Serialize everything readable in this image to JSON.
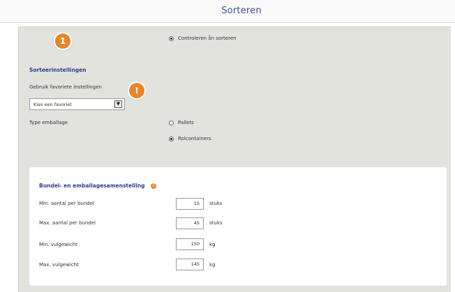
{
  "title": "Sorteren",
  "step_badge": "1",
  "warning_badge": "!",
  "controle_option": "Controleren ån sorteren",
  "sort_settings": {
    "heading": "Sorteerinstellingen",
    "favorites_label": "Gebruik favoriete instellingen",
    "favorite_select_value": "Kies een favoriet",
    "packaging_label": "Type emballage",
    "packaging_options": [
      "Pallets",
      "Rolcontainers"
    ],
    "packaging_selected": "Rolcontainers"
  },
  "bundle": {
    "heading": "Bundel- en emballagesamenstelling",
    "info_icon": "i",
    "rows": [
      {
        "label": "Min. aantal per bundel",
        "value": "15",
        "unit": "stuks"
      },
      {
        "label": "Max. aantal per bundel",
        "value": "45",
        "unit": "stuks"
      },
      {
        "label": "Min. vulgewicht",
        "value": "150",
        "unit": "kg"
      },
      {
        "label": "Max. vulgewicht",
        "value": "145",
        "unit": "kg"
      }
    ]
  },
  "colors": {
    "accent_orange": "#e8852a",
    "title_blue": "#3b4fa0",
    "panel_bg": "#e3e3dd"
  }
}
